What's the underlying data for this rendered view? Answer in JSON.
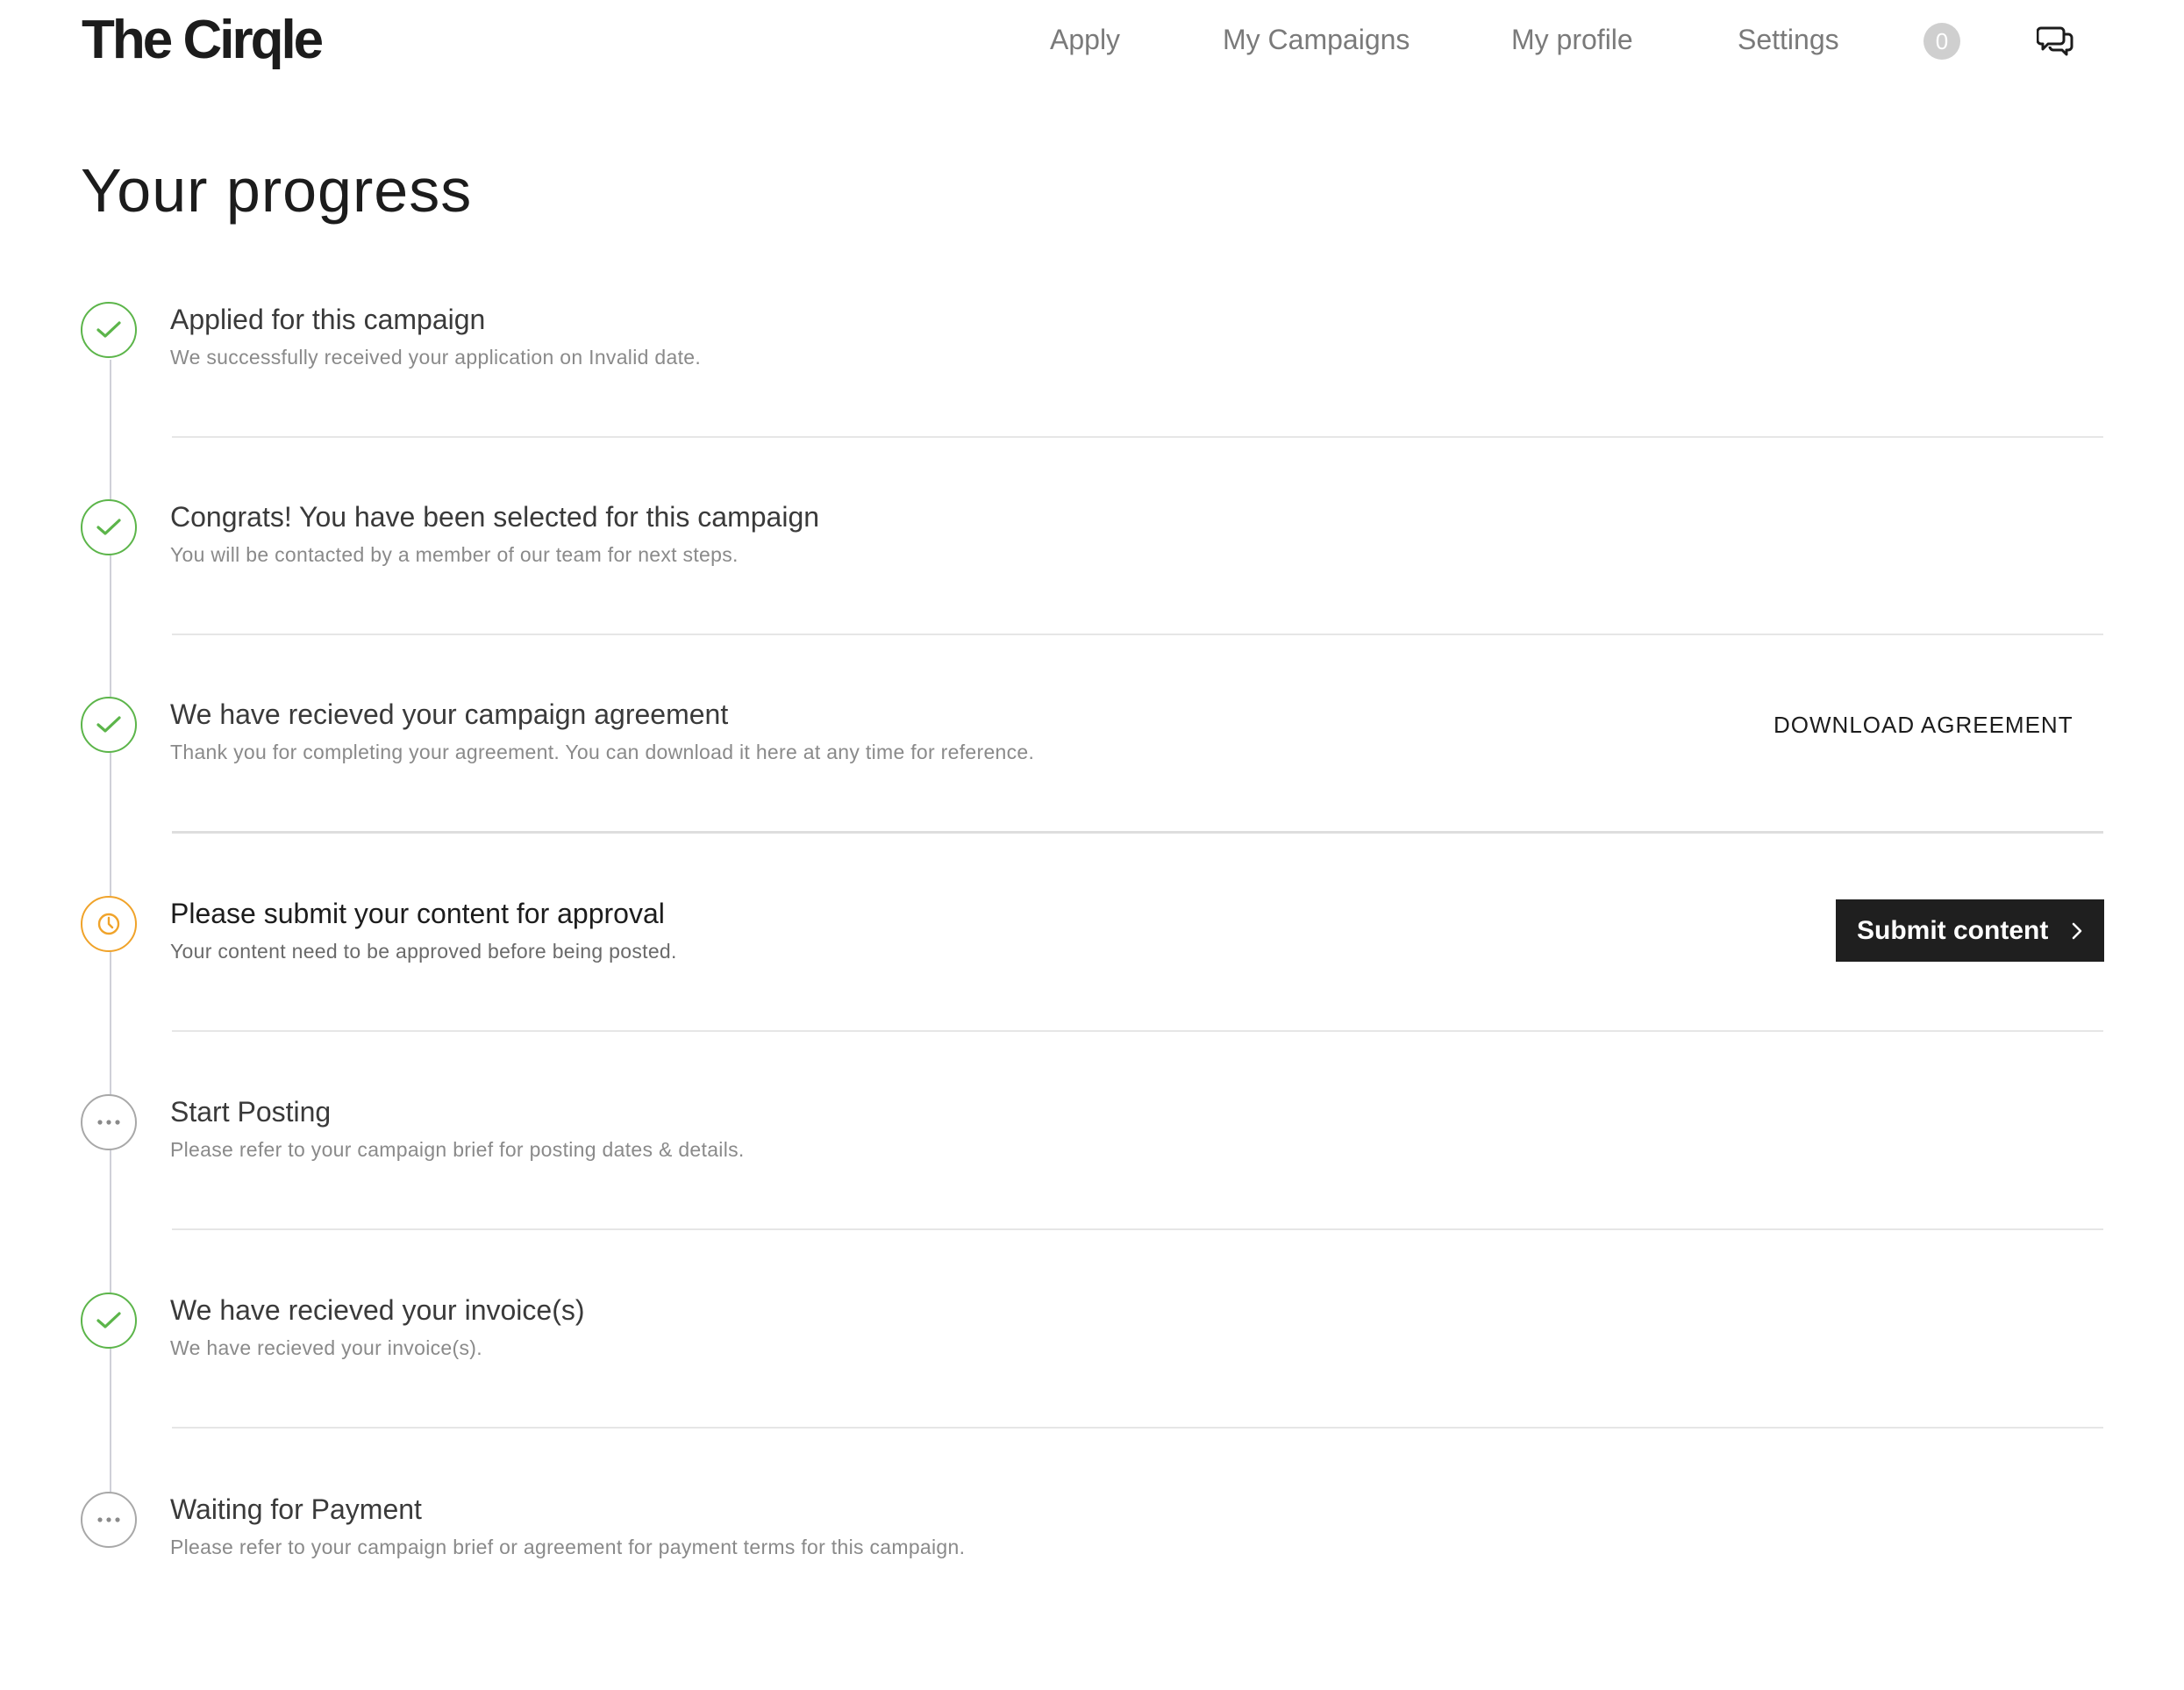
{
  "app": {
    "logo": "The Cirqle"
  },
  "nav": {
    "items": [
      {
        "label": "Apply"
      },
      {
        "label": "My Campaigns"
      },
      {
        "label": "My profile"
      },
      {
        "label": "Settings"
      }
    ],
    "notification_count": "0",
    "chat_icon": "chat-bubbles-icon"
  },
  "page": {
    "title": "Your progress"
  },
  "colors": {
    "done": "#5cb54a",
    "pending": "#f0a32a",
    "waiting": "#a8a8a8",
    "button_bg": "#1f1f1f"
  },
  "steps": [
    {
      "status": "done",
      "icon": "check-icon",
      "title": "Applied for this campaign",
      "description": "We successfully received your application on Invalid date."
    },
    {
      "status": "done",
      "icon": "check-icon",
      "title": "Congrats! You have been selected for this campaign",
      "description": "You will be contacted by a member of our team for next steps."
    },
    {
      "status": "done",
      "icon": "check-icon",
      "title": "We have recieved your campaign agreement",
      "description": "Thank you for completing your agreement. You can download it here at any time for reference.",
      "action_label": "DOWNLOAD AGREEMENT"
    },
    {
      "status": "pending",
      "icon": "clock-icon",
      "title": "Please submit your content for approval",
      "description": "Your content need to be approved before being posted.",
      "action_label": "Submit content"
    },
    {
      "status": "waiting",
      "icon": "ellipsis-icon",
      "title": "Start Posting",
      "description": "Please refer to your campaign brief for posting dates & details."
    },
    {
      "status": "done",
      "icon": "check-icon",
      "title": "We have recieved your invoice(s)",
      "description": "We have recieved your invoice(s)."
    },
    {
      "status": "waiting",
      "icon": "ellipsis-icon",
      "title": "Waiting for Payment",
      "description": "Please refer to your campaign brief or agreement for payment terms for this campaign."
    }
  ]
}
